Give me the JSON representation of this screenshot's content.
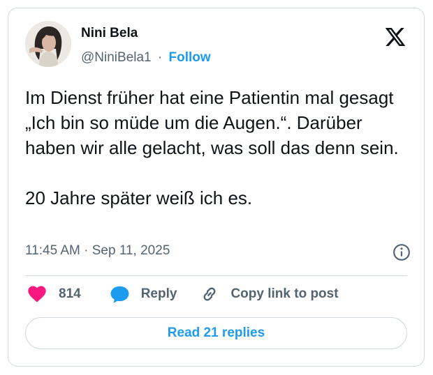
{
  "author": {
    "name": "Nini Bela",
    "handle": "@NiniBela1",
    "separator": "·",
    "follow_label": "Follow",
    "avatar_icon": "profile-photo"
  },
  "brand": {
    "logo_icon": "x-logo"
  },
  "post": {
    "paragraphs": [
      "Im Dienst früher hat eine Patientin mal gesagt „Ich bin so müde um die Augen.“. Darüber haben wir alle gelacht, was soll das denn sein.",
      "20 Jahre später weiß ich es."
    ],
    "timestamp": "11:45 AM · Sep 11, 2025",
    "info_icon": "info-icon"
  },
  "actions": {
    "likes_count": "814",
    "like_icon": "heart-icon",
    "reply_label": "Reply",
    "reply_icon": "speech-bubble-icon",
    "copy_label": "Copy link to post",
    "copy_icon": "link-icon"
  },
  "replies_button": {
    "label": "Read 21 replies"
  },
  "colors": {
    "accent": "#1d9bf0",
    "like": "#f91880",
    "text": "#0f1419",
    "secondary_text": "#536471",
    "border": "#cfd9de"
  }
}
